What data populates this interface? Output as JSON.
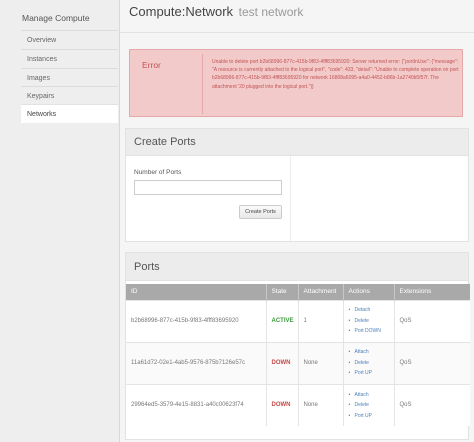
{
  "sidebar": {
    "title": "Manage Compute",
    "items": [
      {
        "label": "Overview"
      },
      {
        "label": "Instances"
      },
      {
        "label": "Images"
      },
      {
        "label": "Keypairs"
      },
      {
        "label": "Networks"
      }
    ]
  },
  "page": {
    "title": "Compute:Network",
    "subtitle": "test network"
  },
  "error": {
    "label": "Error",
    "message": "Unable to delete port b2b68996-877c-415b-9f83-4fff83695920: Server returned error: {\"portInUse\": {\"message\": \"A resource is currently attached to the logical port\", \"code\": 433, \"detail\": \"Unable to complete operation on port b2b68996-877c-415b-9f83-4fff83695920 for network 16808a6095-a4a0-4452-b86b-1a2740b5f57f. The attachment '20 plugged into the logical port.\"}}"
  },
  "create_ports": {
    "heading": "Create Ports",
    "number_label": "Number of Ports",
    "number_value": "",
    "button_label": "Create Ports"
  },
  "ports": {
    "heading": "Ports",
    "columns": [
      "ID",
      "State",
      "Attachment",
      "Actions",
      "Extensions"
    ],
    "rows": [
      {
        "id": "b2b68996-877c-415b-9f83-4fff83695920",
        "state": "ACTIVE",
        "attachment": "1",
        "actions": [
          "Detach",
          "Delete",
          "Port DOWN"
        ],
        "extensions": "QoS"
      },
      {
        "id": "11a61d72-02e1-4ab5-9576-875b7126e57c",
        "state": "DOWN",
        "attachment": "None",
        "actions": [
          "Attach",
          "Delete",
          "Port UP"
        ],
        "extensions": "QoS"
      },
      {
        "id": "29964ed5-3579-4e15-8831-a40c00623f74",
        "state": "DOWN",
        "attachment": "None",
        "actions": [
          "Attach",
          "Delete",
          "Port UP"
        ],
        "extensions": "QoS"
      }
    ]
  },
  "colors": {
    "state_active": "#3c9a3c",
    "state_down": "#c24a4a",
    "error_bg": "#f3caca",
    "link": "#4d7fb8"
  }
}
